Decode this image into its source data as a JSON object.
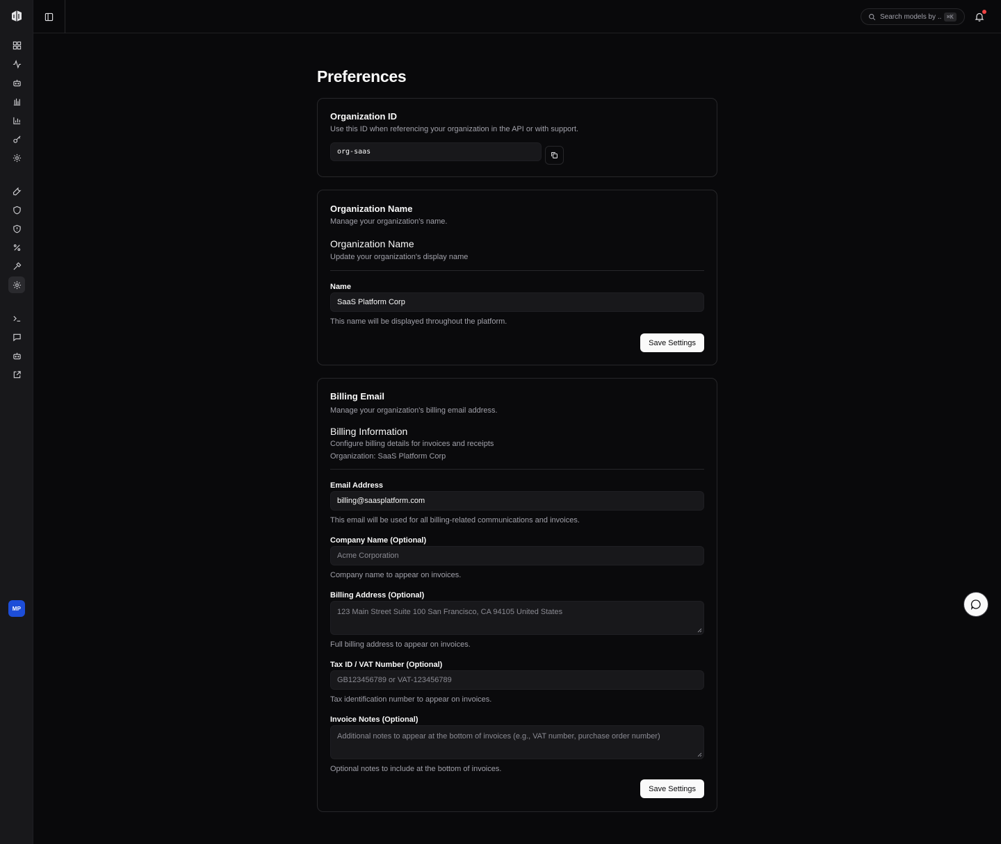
{
  "header": {
    "search_placeholder": "Search models by ...",
    "search_shortcut": "⌘K"
  },
  "user": {
    "initials": "MP"
  },
  "sidebar": {
    "icons": [
      "dashboard-icon",
      "activity-icon",
      "bot-icon",
      "bar-chart-icon",
      "chart-icon",
      "key-icon",
      "settings-icon",
      "wrench-icon",
      "shield-icon",
      "shield-check-icon",
      "percent-icon",
      "hammer-icon",
      "gear-icon",
      "terminal-icon",
      "message-icon",
      "robot-icon",
      "external-link-icon"
    ],
    "active": "gear-icon"
  },
  "page": {
    "title": "Preferences"
  },
  "org_id": {
    "title": "Organization ID",
    "description": "Use this ID when referencing your organization in the API or with support.",
    "value": "org-saas"
  },
  "org_name": {
    "title": "Organization Name",
    "description": "Manage your organization's name.",
    "section_title": "Organization Name",
    "section_desc": "Update your organization's display name",
    "name_label": "Name",
    "name_value": "SaaS Platform Corp",
    "name_help": "This name will be displayed throughout the platform.",
    "save_label": "Save Settings"
  },
  "billing": {
    "title": "Billing Email",
    "description": "Manage your organization's billing email address.",
    "section_title": "Billing Information",
    "section_desc": "Configure billing details for invoices and receipts",
    "section_org": "Organization: SaaS Platform Corp",
    "email_label": "Email Address",
    "email_value": "billing@saasplatform.com",
    "email_help": "This email will be used for all billing-related communications and invoices.",
    "company_label": "Company Name (Optional)",
    "company_placeholder": "Acme Corporation",
    "company_help": "Company name to appear on invoices.",
    "address_label": "Billing Address (Optional)",
    "address_placeholder": "123 Main Street Suite 100 San Francisco, CA 94105 United States",
    "address_help": "Full billing address to appear on invoices.",
    "tax_label": "Tax ID / VAT Number (Optional)",
    "tax_placeholder": "GB123456789 or VAT-123456789",
    "tax_help": "Tax identification number to appear on invoices.",
    "notes_label": "Invoice Notes (Optional)",
    "notes_placeholder": "Additional notes to appear at the bottom of invoices (e.g., VAT number, purchase order number)",
    "notes_help": "Optional notes to include at the bottom of invoices.",
    "save_label": "Save Settings"
  }
}
